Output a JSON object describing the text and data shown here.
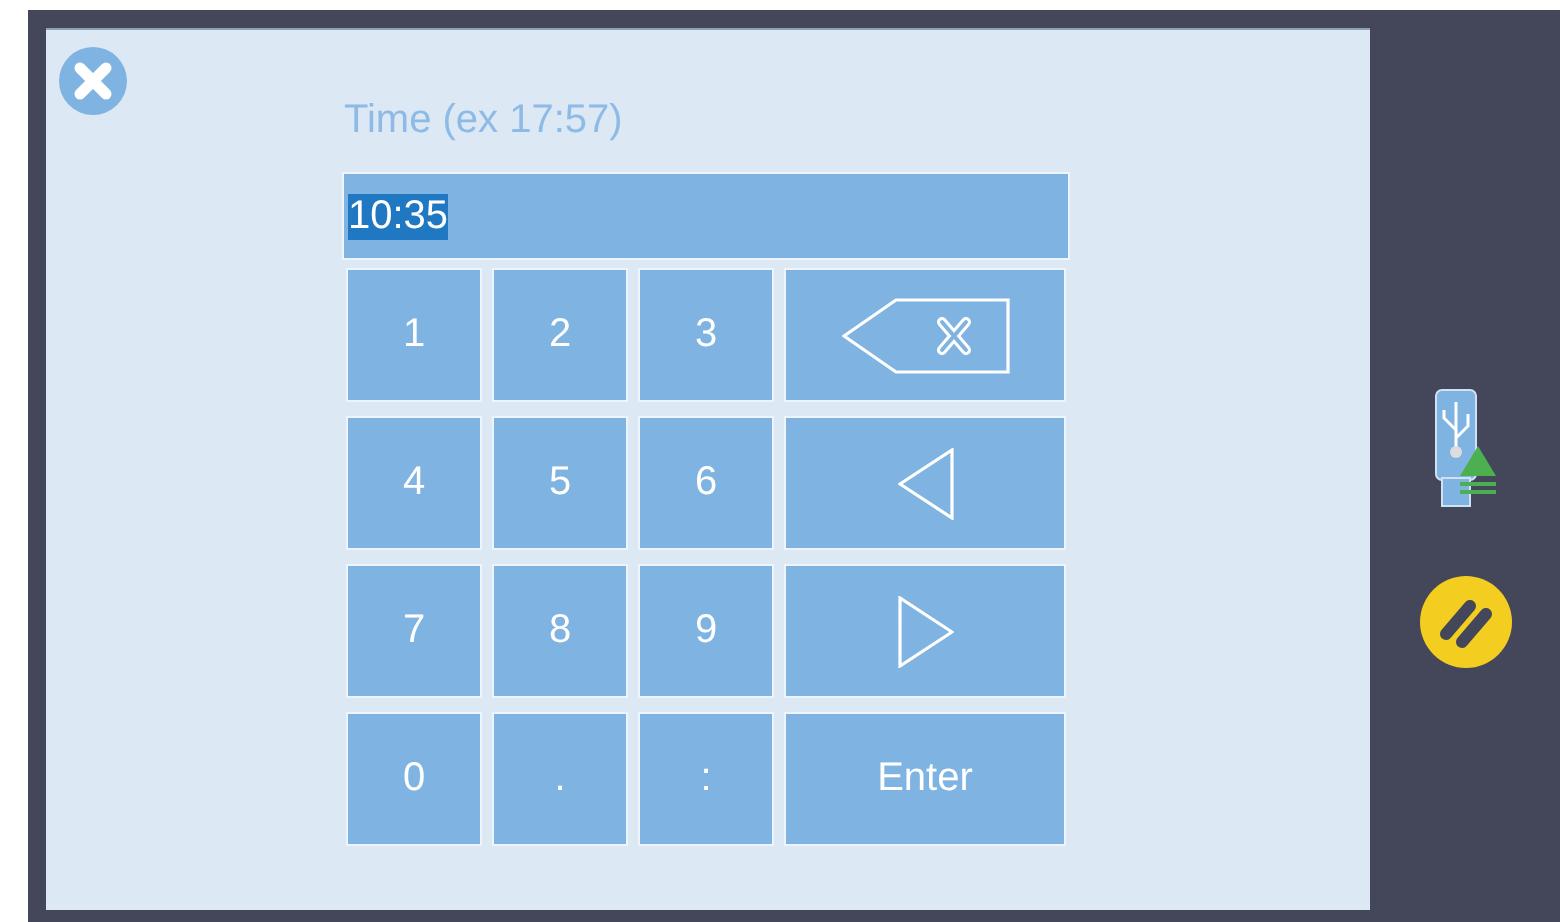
{
  "dialog": {
    "label": "Time (ex 17:57)",
    "field": {
      "value": "10:35",
      "text_selected": true
    }
  },
  "keypad": [
    {
      "kind": "char",
      "label": "1"
    },
    {
      "kind": "char",
      "label": "2"
    },
    {
      "kind": "char",
      "label": "3"
    },
    {
      "kind": "backspace"
    },
    {
      "kind": "char",
      "label": "4"
    },
    {
      "kind": "char",
      "label": "5"
    },
    {
      "kind": "char",
      "label": "6"
    },
    {
      "kind": "cursor-left"
    },
    {
      "kind": "char",
      "label": "7"
    },
    {
      "kind": "char",
      "label": "8"
    },
    {
      "kind": "char",
      "label": "9"
    },
    {
      "kind": "cursor-right"
    },
    {
      "kind": "char",
      "label": "0"
    },
    {
      "kind": "char",
      "label": "."
    },
    {
      "kind": "char",
      "label": ":"
    },
    {
      "kind": "enter",
      "label": "Enter"
    }
  ]
}
